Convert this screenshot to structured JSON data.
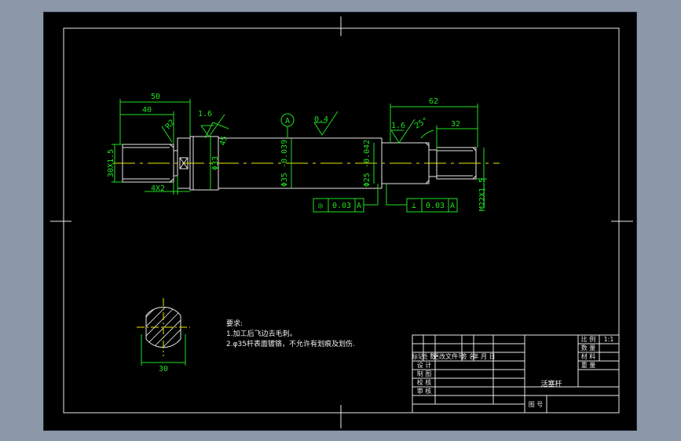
{
  "dims": {
    "len_50": "50",
    "len_40": "40",
    "len_62": "62",
    "len_32": "32",
    "thread_left": "30X1.5",
    "thread_right": "M22X1.5",
    "chamfer": "4X2",
    "dia_33": "Φ33",
    "dia_35": "Φ35 -0.039",
    "dia_25": "Φ25 -0.042",
    "section_width": "30",
    "angle_45": "45",
    "angle_25": "25°",
    "r_label": "R2"
  },
  "roughness": {
    "left": "1.6",
    "middle": "0.4",
    "right": "1.6"
  },
  "datum": {
    "label": "A"
  },
  "tolerance_frames": [
    {
      "symbol": "◎",
      "value": "0.03",
      "datum": "A"
    },
    {
      "symbol": "⊥",
      "value": "0.03",
      "datum": "A"
    }
  ],
  "notes": {
    "title": "要求:",
    "line1": "1.加工后飞边去毛刺。",
    "line2": "2.φ35杆表面镀铬，不允许有划痕及划伤."
  },
  "title_block": {
    "part_name": "活塞杆",
    "scale_label": "比 例",
    "scale_value": "1:1",
    "qty_label": "数 量",
    "material_label": "材 料",
    "weight_label": "重 量",
    "drawing_no_label": "图 号",
    "header": [
      "标记",
      "处 数",
      "更改文件号",
      "签 名",
      "年 月 日"
    ],
    "rows": [
      "设 计",
      "制 图",
      "校 核",
      "审 核"
    ]
  }
}
